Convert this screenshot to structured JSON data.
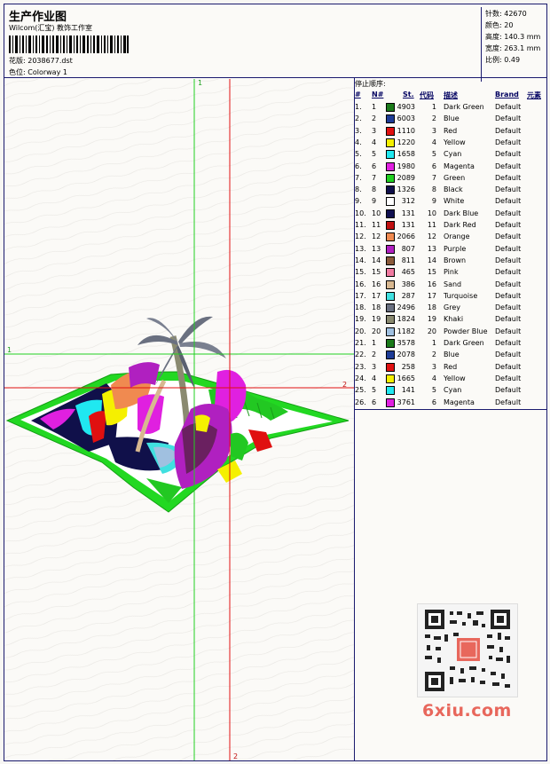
{
  "header": {
    "title": "生产作业图",
    "company": "Wilcom(汇宝) 教饰工作室",
    "design_label": "花版:",
    "design_value": "2038677.dst",
    "colorway_label": "色位:",
    "colorway_value": "Colorway 1"
  },
  "stats": {
    "stitches_label": "针数:",
    "stitches_value": "42670",
    "colors_label": "颜色:",
    "colors_value": "20",
    "height_label": "高度:",
    "height_value": "140.3 mm",
    "width_label": "宽度:",
    "width_value": "263.1 mm",
    "scale_label": "比例:",
    "scale_value": "0.49"
  },
  "guides": {
    "v1": "1",
    "h1": "1",
    "h2": "2",
    "v2": "2"
  },
  "stop_sequence": {
    "title": "停止顺序:",
    "columns": [
      "#",
      "N#",
      "St.",
      "代码",
      "描述",
      "Brand",
      "元素"
    ],
    "rows": [
      {
        "n": "1.",
        "id": "1",
        "st": "4903",
        "code": "1",
        "desc": "Dark Green",
        "brand": "Default",
        "color": "#1a7a1a"
      },
      {
        "n": "2.",
        "id": "2",
        "st": "6003",
        "code": "2",
        "desc": "Blue",
        "brand": "Default",
        "color": "#1e3c96"
      },
      {
        "n": "3.",
        "id": "3",
        "st": "1110",
        "code": "3",
        "desc": "Red",
        "brand": "Default",
        "color": "#e01010"
      },
      {
        "n": "4.",
        "id": "4",
        "st": "1220",
        "code": "4",
        "desc": "Yellow",
        "brand": "Default",
        "color": "#f5f000"
      },
      {
        "n": "5.",
        "id": "5",
        "st": "1658",
        "code": "5",
        "desc": "Cyan",
        "brand": "Default",
        "color": "#20e8f0"
      },
      {
        "n": "6.",
        "id": "6",
        "st": "1980",
        "code": "6",
        "desc": "Magenta",
        "brand": "Default",
        "color": "#e020e0"
      },
      {
        "n": "7.",
        "id": "7",
        "st": "2089",
        "code": "7",
        "desc": "Green",
        "brand": "Default",
        "color": "#20d020"
      },
      {
        "n": "8.",
        "id": "8",
        "st": "1326",
        "code": "8",
        "desc": "Black",
        "brand": "Default",
        "color": "#10104a"
      },
      {
        "n": "9.",
        "id": "9",
        "st": "312",
        "code": "9",
        "desc": "White",
        "brand": "Default",
        "color": "#ffffff"
      },
      {
        "n": "10.",
        "id": "10",
        "st": "131",
        "code": "10",
        "desc": "Dark Blue",
        "brand": "Default",
        "color": "#101050"
      },
      {
        "n": "11.",
        "id": "11",
        "st": "131",
        "code": "11",
        "desc": "Dark Red",
        "brand": "Default",
        "color": "#c01010"
      },
      {
        "n": "12.",
        "id": "12",
        "st": "2066",
        "code": "12",
        "desc": "Orange",
        "brand": "Default",
        "color": "#f08a50"
      },
      {
        "n": "13.",
        "id": "13",
        "st": "807",
        "code": "13",
        "desc": "Purple",
        "brand": "Default",
        "color": "#b020c0"
      },
      {
        "n": "14.",
        "id": "14",
        "st": "811",
        "code": "14",
        "desc": "Brown",
        "brand": "Default",
        "color": "#8a5a3a"
      },
      {
        "n": "15.",
        "id": "15",
        "st": "465",
        "code": "15",
        "desc": "Pink",
        "brand": "Default",
        "color": "#f07aa0"
      },
      {
        "n": "16.",
        "id": "16",
        "st": "386",
        "code": "16",
        "desc": "Sand",
        "brand": "Default",
        "color": "#d8b890"
      },
      {
        "n": "17.",
        "id": "17",
        "st": "287",
        "code": "17",
        "desc": "Turquoise",
        "brand": "Default",
        "color": "#40e0e0"
      },
      {
        "n": "18.",
        "id": "18",
        "st": "2496",
        "code": "18",
        "desc": "Grey",
        "brand": "Default",
        "color": "#6a7080"
      },
      {
        "n": "19.",
        "id": "19",
        "st": "1824",
        "code": "19",
        "desc": "Khaki",
        "brand": "Default",
        "color": "#8a8a70"
      },
      {
        "n": "20.",
        "id": "20",
        "st": "1182",
        "code": "20",
        "desc": "Powder Blue",
        "brand": "Default",
        "color": "#a0c0e0"
      },
      {
        "n": "21.",
        "id": "1",
        "st": "3578",
        "code": "1",
        "desc": "Dark Green",
        "brand": "Default",
        "color": "#1a7a1a"
      },
      {
        "n": "22.",
        "id": "2",
        "st": "2078",
        "code": "2",
        "desc": "Blue",
        "brand": "Default",
        "color": "#1e3c96"
      },
      {
        "n": "23.",
        "id": "3",
        "st": "258",
        "code": "3",
        "desc": "Red",
        "brand": "Default",
        "color": "#e01010"
      },
      {
        "n": "24.",
        "id": "4",
        "st": "1665",
        "code": "4",
        "desc": "Yellow",
        "brand": "Default",
        "color": "#f5f000"
      },
      {
        "n": "25.",
        "id": "5",
        "st": "141",
        "code": "5",
        "desc": "Cyan",
        "brand": "Default",
        "color": "#20e8f0"
      },
      {
        "n": "26.",
        "id": "6",
        "st": "3761",
        "code": "6",
        "desc": "Magenta",
        "brand": "Default",
        "color": "#e020e0"
      }
    ]
  },
  "watermark": "6xiu.com"
}
